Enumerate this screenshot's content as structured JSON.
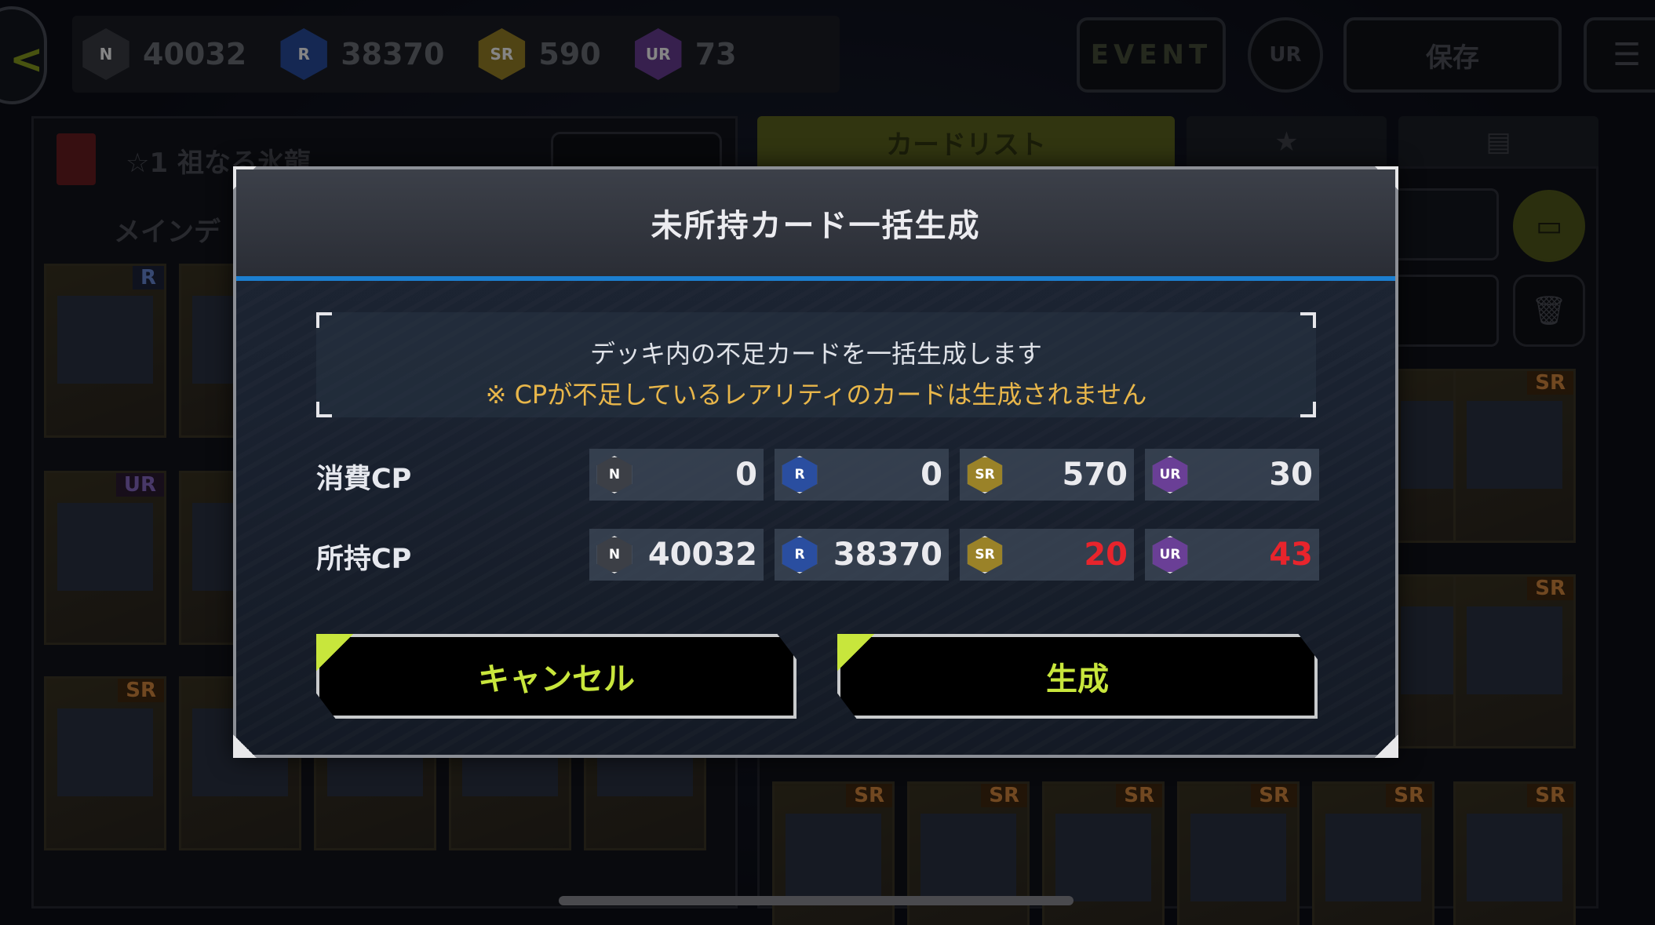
{
  "topbar": {
    "cp": [
      {
        "grade": "N",
        "label_top": "CP",
        "label": "N",
        "value": "40032",
        "color": "#5a5d66"
      },
      {
        "grade": "R",
        "label_top": "CP",
        "label": "R",
        "value": "38370",
        "color": "#2e4c8c"
      },
      {
        "grade": "SR",
        "label_top": "CP",
        "label": "SR",
        "value": "590",
        "color": "#7a6a2a"
      },
      {
        "grade": "UR",
        "label_top": "CP",
        "label": "UR",
        "value": "73",
        "color": "#5a3a7a"
      }
    ],
    "event_label": "EVENT",
    "ur_label": "UR",
    "save_label": "保存"
  },
  "deck": {
    "title": "☆1 祖なる氷龍",
    "section": "メインデ"
  },
  "tabs": {
    "cardlist": "カードリスト"
  },
  "modal": {
    "title": "未所持カード一括生成",
    "info_line1": "デッキ内の不足カードを一括生成します",
    "info_line2": "※ CPが不足しているレアリティのカードは生成されません",
    "rows": [
      {
        "label": "消費CP",
        "cells": [
          {
            "grade": "N",
            "value": "0",
            "warn": false
          },
          {
            "grade": "R",
            "value": "0",
            "warn": false
          },
          {
            "grade": "SR",
            "value": "570",
            "warn": false
          },
          {
            "grade": "UR",
            "value": "30",
            "warn": false
          }
        ]
      },
      {
        "label": "所持CP",
        "cells": [
          {
            "grade": "N",
            "value": "40032",
            "warn": false
          },
          {
            "grade": "R",
            "value": "38370",
            "warn": false
          },
          {
            "grade": "SR",
            "value": "20",
            "warn": true
          },
          {
            "grade": "UR",
            "value": "43",
            "warn": true
          }
        ]
      }
    ],
    "cancel_label": "キャンセル",
    "generate_label": "生成"
  },
  "grade_colors": {
    "N": "#3c3f46",
    "R": "#2a4ea0",
    "SR": "#9a8228",
    "UR": "#6a3f96"
  },
  "cards": {
    "rarities_left": [
      "R",
      "",
      "UR",
      "",
      "SR",
      "SR",
      "",
      "",
      ""
    ],
    "rarities_right": [
      "SR",
      "SR",
      "SR",
      "SR",
      "SR",
      "SR",
      "SR",
      "SR",
      "SR",
      "SR"
    ]
  }
}
